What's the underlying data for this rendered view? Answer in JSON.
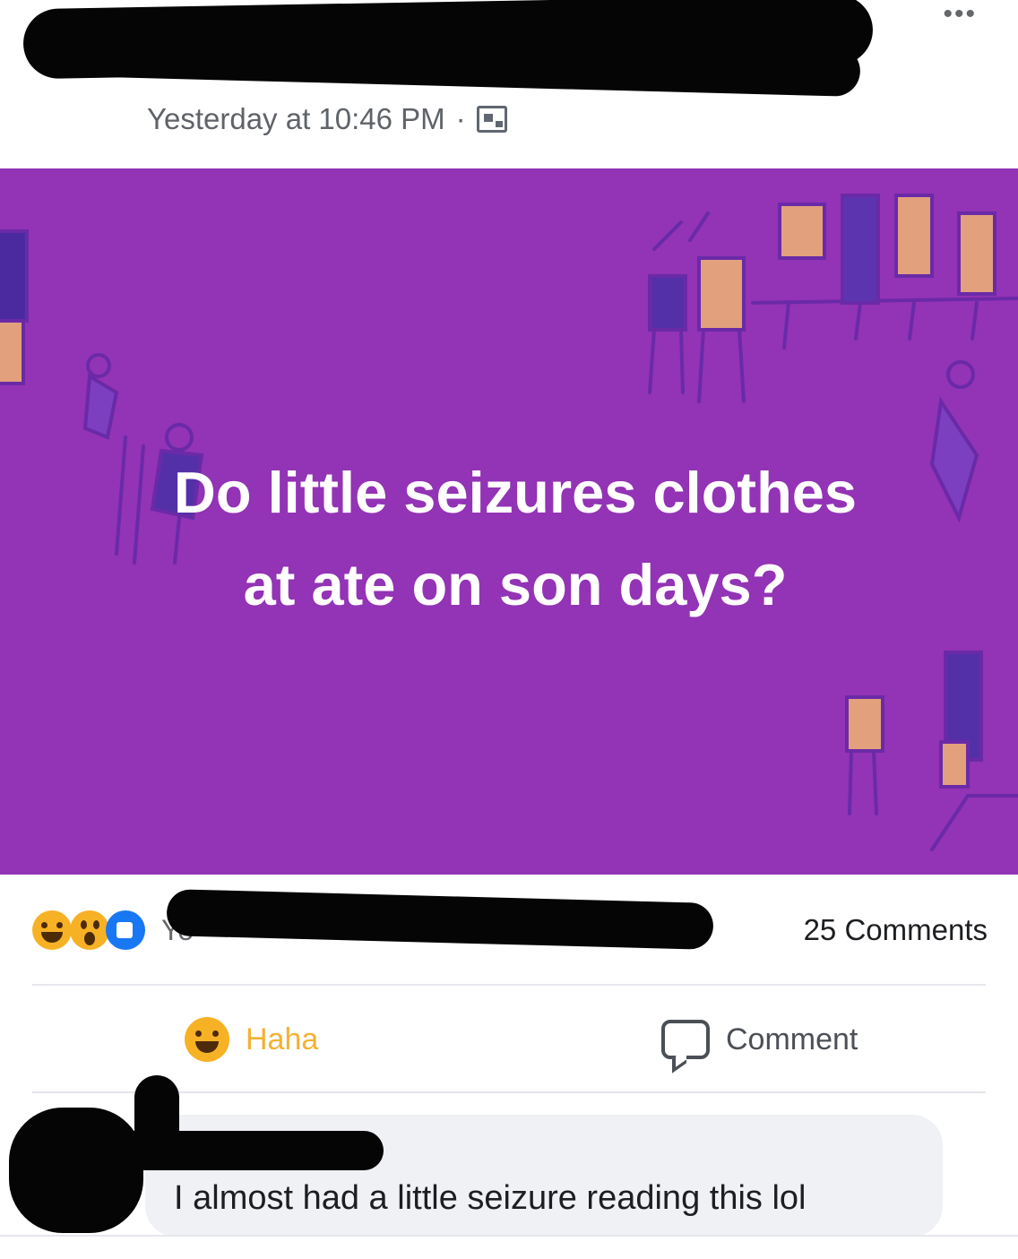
{
  "header": {
    "timestamp": "Yesterday at 10:46 PM",
    "separator": "·",
    "privacy_icon": "photo-icon",
    "more_icon": "more-options-icon",
    "more_label": "•••"
  },
  "post": {
    "background_color": "#9333b5",
    "text_line1": "Do little seizures clothes",
    "text_line2": "at ate on son days?"
  },
  "reactions": {
    "icons": [
      "haha-icon",
      "wow-icon",
      "like-icon"
    ],
    "label_visible": "Yo",
    "comments_count": "25 Comments"
  },
  "actions": {
    "haha_label": "Haha",
    "comment_label": "Comment"
  },
  "comment": {
    "text": "I almost had a little seizure reading this lol"
  }
}
